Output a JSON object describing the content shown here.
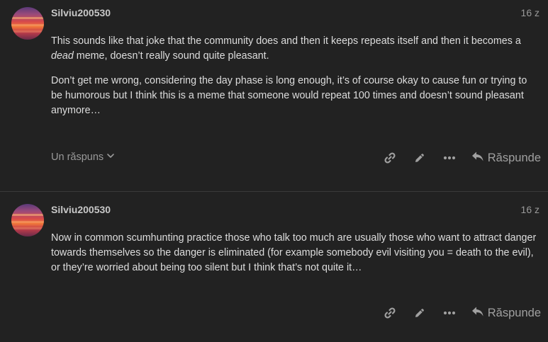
{
  "posts": [
    {
      "username": "Silviu200530",
      "date": "16 z",
      "paragraph1_before": "This sounds like that joke that the community does and then it keeps repeats itself and then it becomes a ",
      "paragraph1_em": "dead",
      "paragraph1_after": " meme, doesn’t really sound quite pleasant.",
      "paragraph2": "Don’t get me wrong, considering the day phase is long enough, it’s of course okay to cause fun or trying to be humorous but I think this is a meme that someone would repeat 100 times and doesn’t sound pleasant anymore…",
      "replies_label": "Un răspuns",
      "reply_label": "Răspunde"
    },
    {
      "username": "Silviu200530",
      "date": "16 z",
      "paragraph1": "Now in common scumhunting practice those who talk too much are usually those who want to attract danger towards themselves so the danger is eliminated (for example somebody evil visiting you = death to the evil), or they’re worried about being too silent but I think that’s not quite it…",
      "reply_label": "Răspunde"
    }
  ],
  "icons": {
    "link": "link-icon",
    "edit": "pencil-icon",
    "more": "more-dots-icon",
    "reply": "reply-arrow-icon",
    "expand": "chevron-down-icon"
  },
  "colors": {
    "background": "#222222",
    "text": "#dddddd",
    "muted": "#9a9a9a",
    "username": "#c8c8c8",
    "divider": "#3a3a3a"
  }
}
